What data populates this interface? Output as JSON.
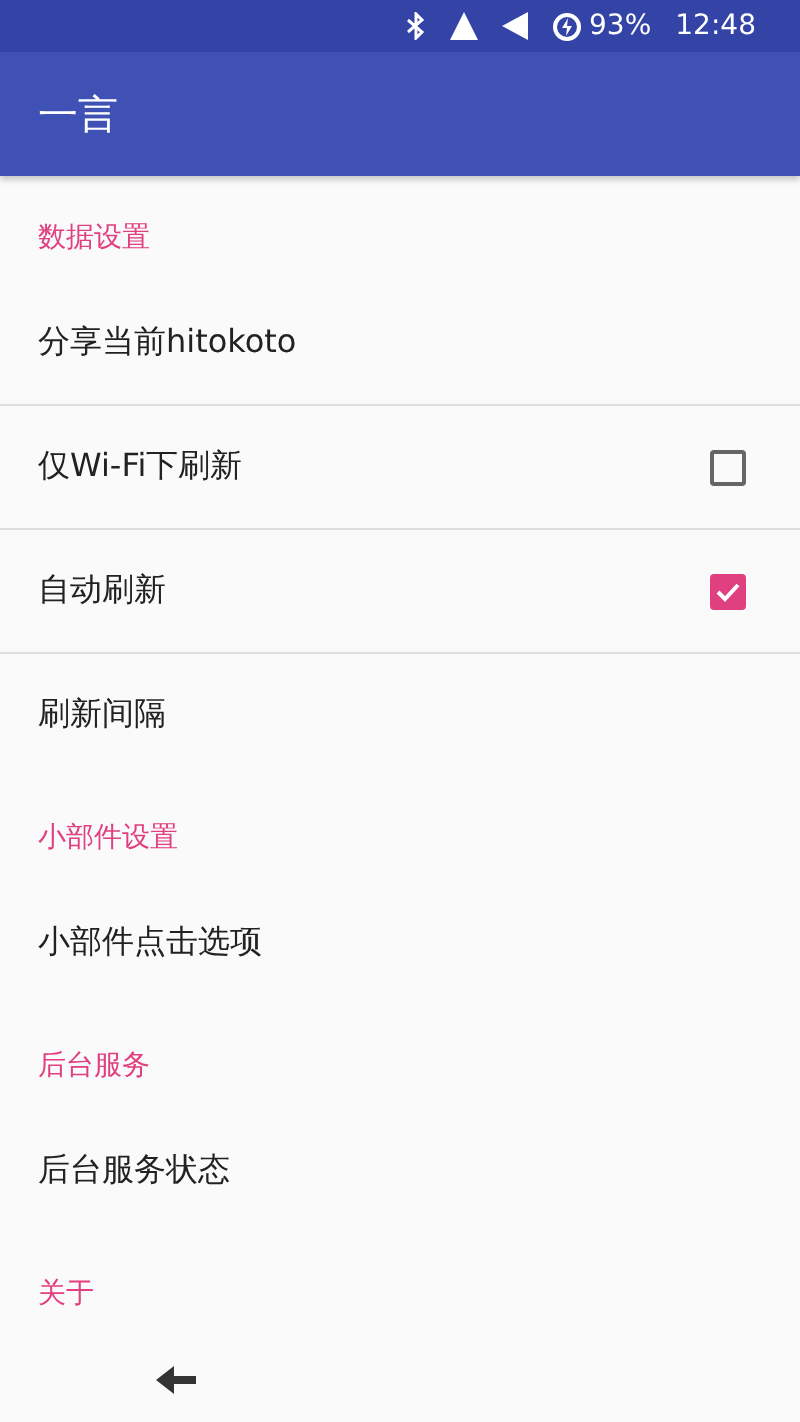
{
  "status_bar": {
    "battery": "93%",
    "time": "12:48"
  },
  "app_bar": {
    "title": "一言"
  },
  "sections": [
    {
      "header": "数据设置",
      "items": [
        {
          "label": "分享当前hitokoto",
          "kind": "plain"
        },
        {
          "label": "仅Wi-Fi下刷新",
          "kind": "checkbox",
          "checked": false
        },
        {
          "label": "自动刷新",
          "kind": "checkbox",
          "checked": true
        },
        {
          "label": "刷新间隔",
          "kind": "plain"
        }
      ]
    },
    {
      "header": "小部件设置",
      "items": [
        {
          "label": "小部件点击选项",
          "kind": "plain"
        }
      ]
    },
    {
      "header": "后台服务",
      "items": [
        {
          "label": "后台服务状态",
          "kind": "plain"
        }
      ]
    },
    {
      "header": "关于"
    }
  ]
}
